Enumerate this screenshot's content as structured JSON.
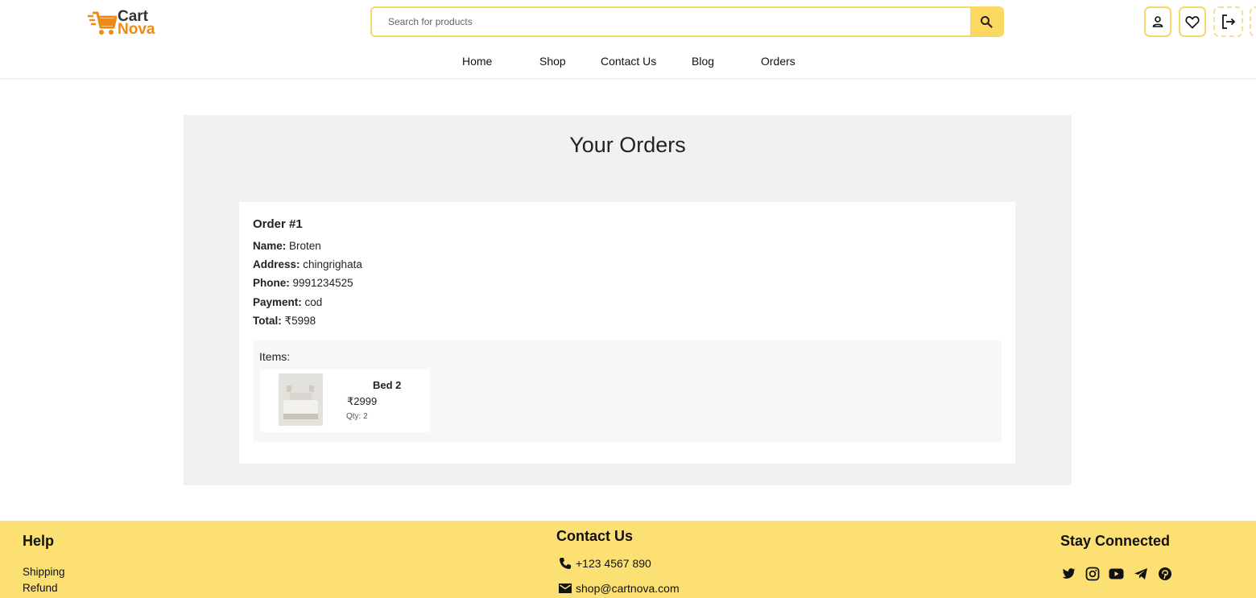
{
  "brand": {
    "name_top": "Cart",
    "name_bottom": "Nova",
    "accent": "#f08a14",
    "yellow": "#fde073"
  },
  "search": {
    "placeholder": "Search for products"
  },
  "nav": [
    "Home",
    "Shop",
    "Contact Us",
    "Blog",
    "Orders"
  ],
  "header_icons": [
    "user-icon",
    "heart-icon",
    "logout-icon"
  ],
  "orders": {
    "title": "Your Orders",
    "list": [
      {
        "id_label": "Order #1",
        "name_label": "Name:",
        "name": "Broten",
        "address_label": "Address:",
        "address": "chingrighata",
        "phone_label": "Phone:",
        "phone": "9991234525",
        "payment_label": "Payment:",
        "payment": "cod",
        "total_label": "Total:",
        "total": "₹5998",
        "items_label": "Items:",
        "items": [
          {
            "name": "Bed 2",
            "price": "₹2999",
            "qty": "Qty: 2"
          }
        ]
      }
    ]
  },
  "footer": {
    "help_title": "Help",
    "help_links": [
      "Shipping",
      "Refund"
    ],
    "contact_title": "Contact Us",
    "phone": "+123 4567 890",
    "email": "shop@cartnova.com",
    "stay_title": "Stay Connected",
    "socials": [
      "twitter-icon",
      "instagram-icon",
      "youtube-icon",
      "telegram-icon",
      "pinterest-icon"
    ]
  }
}
